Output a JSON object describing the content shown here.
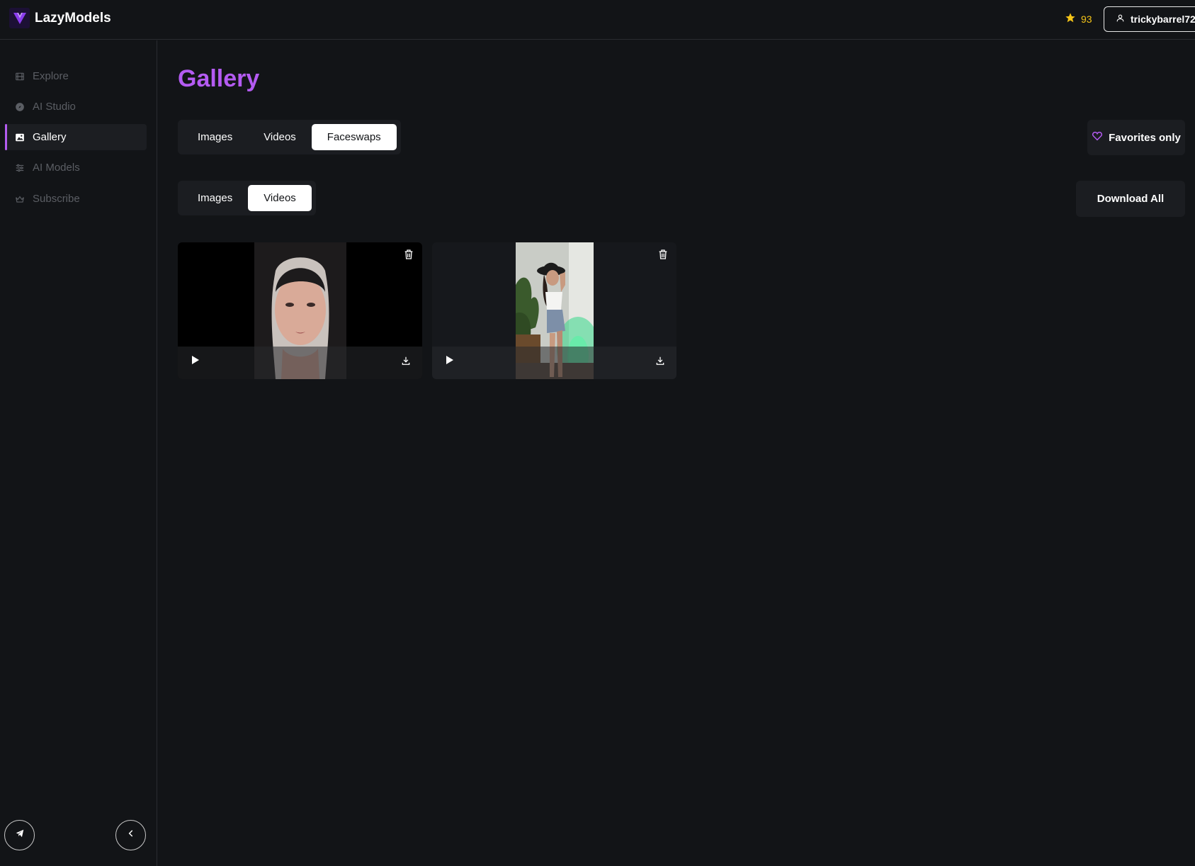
{
  "app": {
    "name": "LazyModels"
  },
  "header": {
    "credits": "93",
    "username": "trickybarrel72"
  },
  "sidebar": {
    "items": [
      {
        "label": "Explore",
        "icon": "film-icon",
        "active": false
      },
      {
        "label": "AI Studio",
        "icon": "compass-icon",
        "active": false
      },
      {
        "label": "Gallery",
        "icon": "image-icon",
        "active": true
      },
      {
        "label": "AI Models",
        "icon": "sliders-icon",
        "active": false
      },
      {
        "label": "Subscribe",
        "icon": "crown-icon",
        "active": false
      }
    ]
  },
  "main": {
    "title": "Gallery",
    "type_tabs": [
      {
        "label": "Images",
        "active": false
      },
      {
        "label": "Videos",
        "active": false
      },
      {
        "label": "Faceswaps",
        "active": true
      }
    ],
    "media_tabs": [
      {
        "label": "Images",
        "active": false
      },
      {
        "label": "Videos",
        "active": true
      }
    ],
    "favorites_label": "Favorites only",
    "download_all_label": "Download All",
    "cards": [
      {
        "kind": "portrait-face-video"
      },
      {
        "kind": "cowgirl-room-video"
      }
    ]
  },
  "colors": {
    "accent": "#b45bf2",
    "star": "#f5c518",
    "background": "#121417"
  }
}
